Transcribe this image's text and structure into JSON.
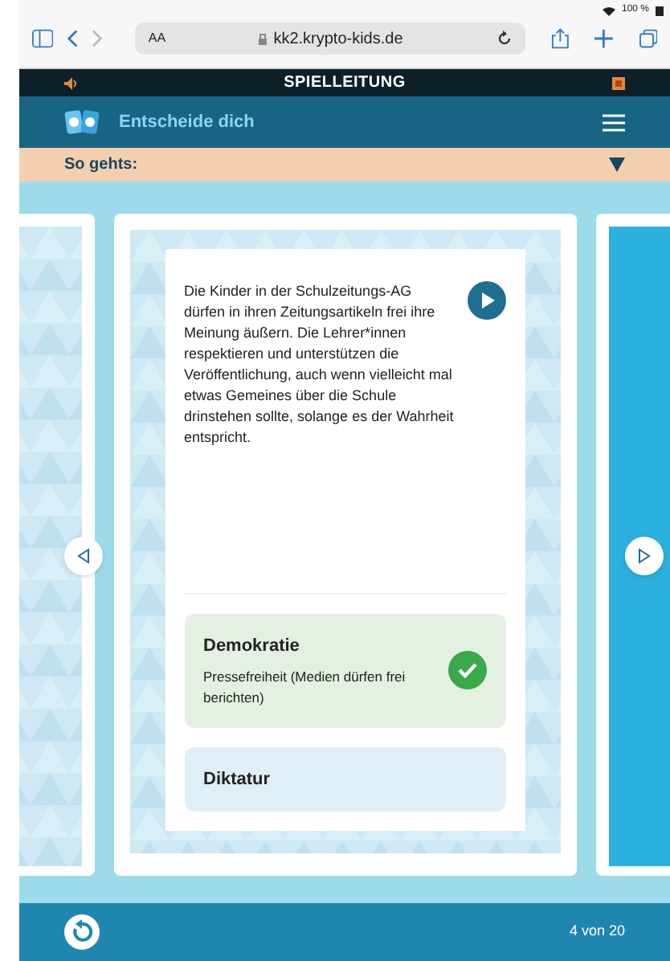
{
  "status_bar": {
    "battery": "100 %"
  },
  "browser": {
    "reader": "AA",
    "url": "kk2.krypto-kids.de"
  },
  "top_bar": {
    "title": "SPIELLEITUNG"
  },
  "header": {
    "title": "Entscheide dich"
  },
  "howto": {
    "label": "So gehts:",
    "expanded": false
  },
  "card": {
    "text": "Die Kinder in der Schulzeitungs-AG dürfen in ihren Zeitungsartikeln frei ihre Meinung äußern. Die Lehrer*innen respektieren und unterstützen die Veröffentlichung, auch wenn vielleicht mal etwas Gemeines über die Schule drinstehen sollte, solange es der Wahrheit entspricht.",
    "answers": [
      {
        "title": "Demokratie",
        "detail": "Pressefreiheit (Medien dürfen frei berichten)",
        "selected": true
      },
      {
        "title": "Diktatur",
        "selected": false
      }
    ]
  },
  "footer": {
    "progress": "4 von 20"
  }
}
